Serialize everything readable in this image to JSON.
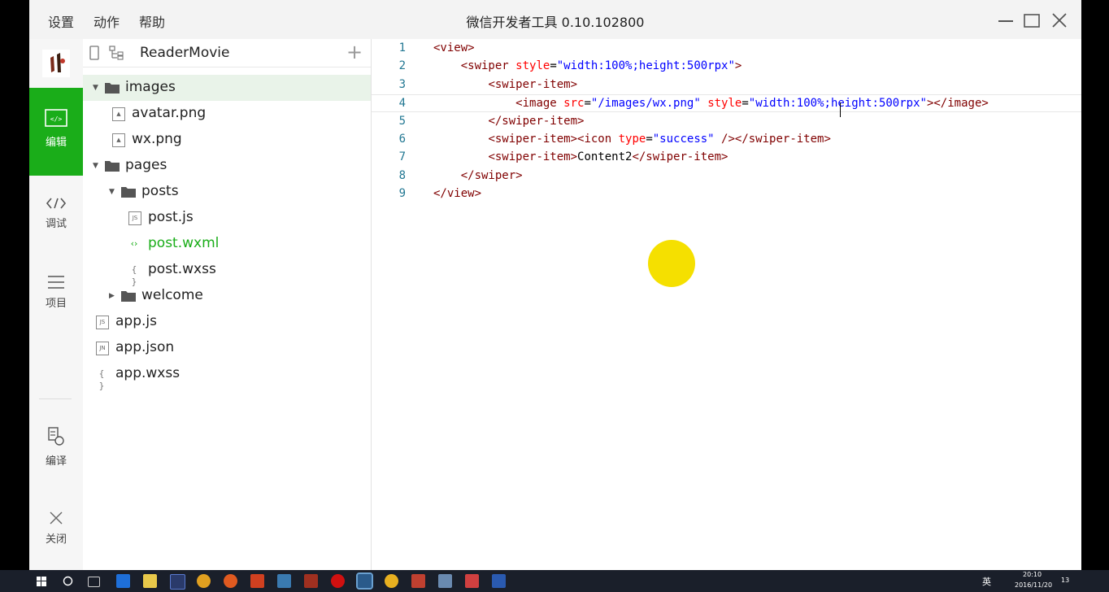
{
  "window": {
    "title": "微信开发者工具 0.10.102800",
    "menu": [
      "设置",
      "动作",
      "帮助"
    ]
  },
  "nav": {
    "edit": "编辑",
    "debug": "调试",
    "project": "项目",
    "compile": "编译",
    "close": "关闭"
  },
  "tree": {
    "project_name": "ReaderMovie",
    "add_symbol": "+",
    "nodes": [
      {
        "label": "images",
        "type": "folder",
        "depth": 0,
        "expanded": true
      },
      {
        "label": "avatar.png",
        "type": "image",
        "depth": 1
      },
      {
        "label": "wx.png",
        "type": "image",
        "depth": 1
      },
      {
        "label": "pages",
        "type": "folder",
        "depth": 0,
        "expanded": true
      },
      {
        "label": "posts",
        "type": "folder",
        "depth": 1,
        "expanded": true
      },
      {
        "label": "post.js",
        "type": "js",
        "depth": 2
      },
      {
        "label": "post.wxml",
        "type": "wxml",
        "depth": 2,
        "active": true
      },
      {
        "label": "post.wxss",
        "type": "wxss",
        "depth": 2
      },
      {
        "label": "welcome",
        "type": "folder",
        "depth": 1,
        "expanded": false
      },
      {
        "label": "app.js",
        "type": "js",
        "depth": 0
      },
      {
        "label": "app.json",
        "type": "json",
        "depth": 0
      },
      {
        "label": "app.wxss",
        "type": "wxss",
        "depth": 0
      }
    ]
  },
  "editor": {
    "current_line": 4,
    "lines": [
      {
        "n": "1",
        "tokens": [
          [
            "tg",
            "<view>"
          ]
        ]
      },
      {
        "n": "2",
        "tokens": [
          [
            "tx",
            "    "
          ],
          [
            "tg",
            "<swiper "
          ],
          [
            "at",
            "style"
          ],
          [
            "tx",
            "="
          ],
          [
            "vl",
            "\"width:100%;height:500rpx\""
          ],
          [
            "tg",
            ">"
          ]
        ]
      },
      {
        "n": "3",
        "tokens": [
          [
            "tx",
            "        "
          ],
          [
            "tg",
            "<swiper-item>"
          ]
        ]
      },
      {
        "n": "4",
        "tokens": [
          [
            "tx",
            "            "
          ],
          [
            "tg",
            "<image "
          ],
          [
            "at",
            "src"
          ],
          [
            "tx",
            "="
          ],
          [
            "vl",
            "\"/images/wx.png\""
          ],
          [
            "tx",
            " "
          ],
          [
            "at",
            "style"
          ],
          [
            "tx",
            "="
          ],
          [
            "vl",
            "\"width:100%;height:500rpx\""
          ],
          [
            "tg",
            "></image>"
          ]
        ]
      },
      {
        "n": "5",
        "tokens": [
          [
            "tx",
            "        "
          ],
          [
            "tg",
            "</swiper-item>"
          ]
        ]
      },
      {
        "n": "6",
        "tokens": [
          [
            "tx",
            "        "
          ],
          [
            "tg",
            "<swiper-item><icon "
          ],
          [
            "at",
            "type"
          ],
          [
            "tx",
            "="
          ],
          [
            "vl",
            "\"success\""
          ],
          [
            "tg",
            " /></swiper-item>"
          ]
        ]
      },
      {
        "n": "7",
        "tokens": [
          [
            "tx",
            "        "
          ],
          [
            "tg",
            "<swiper-item>"
          ],
          [
            "tx",
            "Content2"
          ],
          [
            "tg",
            "</swiper-item>"
          ]
        ]
      },
      {
        "n": "8",
        "tokens": [
          [
            "tx",
            "    "
          ],
          [
            "tg",
            "</swiper>"
          ]
        ]
      },
      {
        "n": "9",
        "tokens": [
          [
            "tg",
            "</view>"
          ]
        ]
      }
    ]
  },
  "taskbar": {
    "time": "20:10",
    "date": "2016/11/20",
    "ime": "英",
    "notifications": "13"
  },
  "colors": {
    "accent": "#1aad19",
    "cursor_highlight": "#f5e000"
  }
}
